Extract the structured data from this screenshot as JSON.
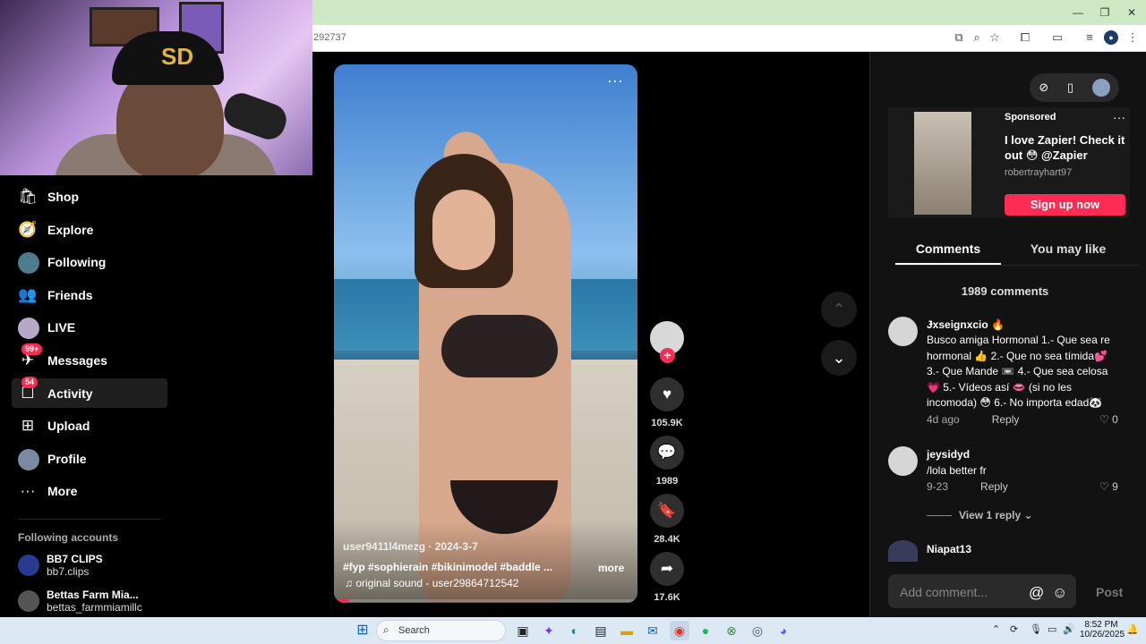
{
  "browser": {
    "url_fragment": "292737",
    "window_controls": [
      "minimize",
      "restore",
      "close"
    ]
  },
  "sidebar": {
    "items": [
      {
        "label": "Shop",
        "icon": "shopping-bag-icon"
      },
      {
        "label": "Explore",
        "icon": "compass-icon"
      },
      {
        "label": "Following",
        "icon": "avatar-icon"
      },
      {
        "label": "Friends",
        "icon": "people-icon"
      },
      {
        "label": "LIVE",
        "icon": "live-avatar-icon"
      },
      {
        "label": "Messages",
        "icon": "paper-plane-icon",
        "badge": "99+"
      },
      {
        "label": "Activity",
        "icon": "inbox-icon",
        "badge": "54"
      },
      {
        "label": "Upload",
        "icon": "plus-square-icon"
      },
      {
        "label": "Profile",
        "icon": "profile-avatar-icon"
      },
      {
        "label": "More",
        "icon": "ellipsis-icon"
      }
    ],
    "following_heading": "Following accounts",
    "accounts": [
      {
        "name": "BB7 CLIPS",
        "handle": "bb7.clips"
      },
      {
        "name": "Bettas Farm Mia...",
        "handle": "bettas_farmmiamillc"
      }
    ]
  },
  "video": {
    "author_line": "user9411l4mezg · 2024-3-7",
    "tags": "#fyp  #sophierain  #bikinimodel  #baddle  ...",
    "more_label": "more",
    "sound": "original sound - user29864712542",
    "progress": 0.05
  },
  "actions": {
    "likes": "105.9K",
    "comments": "1989",
    "saves": "28.4K",
    "shares": "17.6K"
  },
  "right_panel": {
    "ad": {
      "sponsored": "Sponsored",
      "title": "I love Zapier! Check it out 😳 @Zapier",
      "author": "robertrayhart97",
      "cta": "Sign up now"
    },
    "tabs": {
      "comments": "Comments",
      "may_like": "You may like"
    },
    "comments_count": "1989 comments",
    "comments": [
      {
        "user": "Ɉxseignxcio 🔥",
        "text": "Busco amiga Hormonal 1.- Que sea re hormonal 👍 2.- Que no sea tímida💕 3.- Que Mande 📼 4.- Que sea celosa 💗 5.- Vídeos así 👄 (si no les incomoda) 😳 6.- No importa edad🐼",
        "time": "4d ago",
        "reply": "Reply",
        "likes": "0"
      },
      {
        "user": "jeysidyd",
        "text": "/lola better fr",
        "time": "9-23",
        "reply": "Reply",
        "likes": "9"
      },
      {
        "user": "Niapat13"
      }
    ],
    "view_reply": "View 1 reply ⌄",
    "add_comment_placeholder": "Add comment...",
    "post_label": "Post"
  },
  "taskbar": {
    "search_label": "Search",
    "time": "8:52 PM",
    "date": "10/26/2025"
  },
  "colors": {
    "accent": "#fe2c55",
    "panel_bg": "#121212",
    "taskbar_bg": "#dce9f5"
  }
}
